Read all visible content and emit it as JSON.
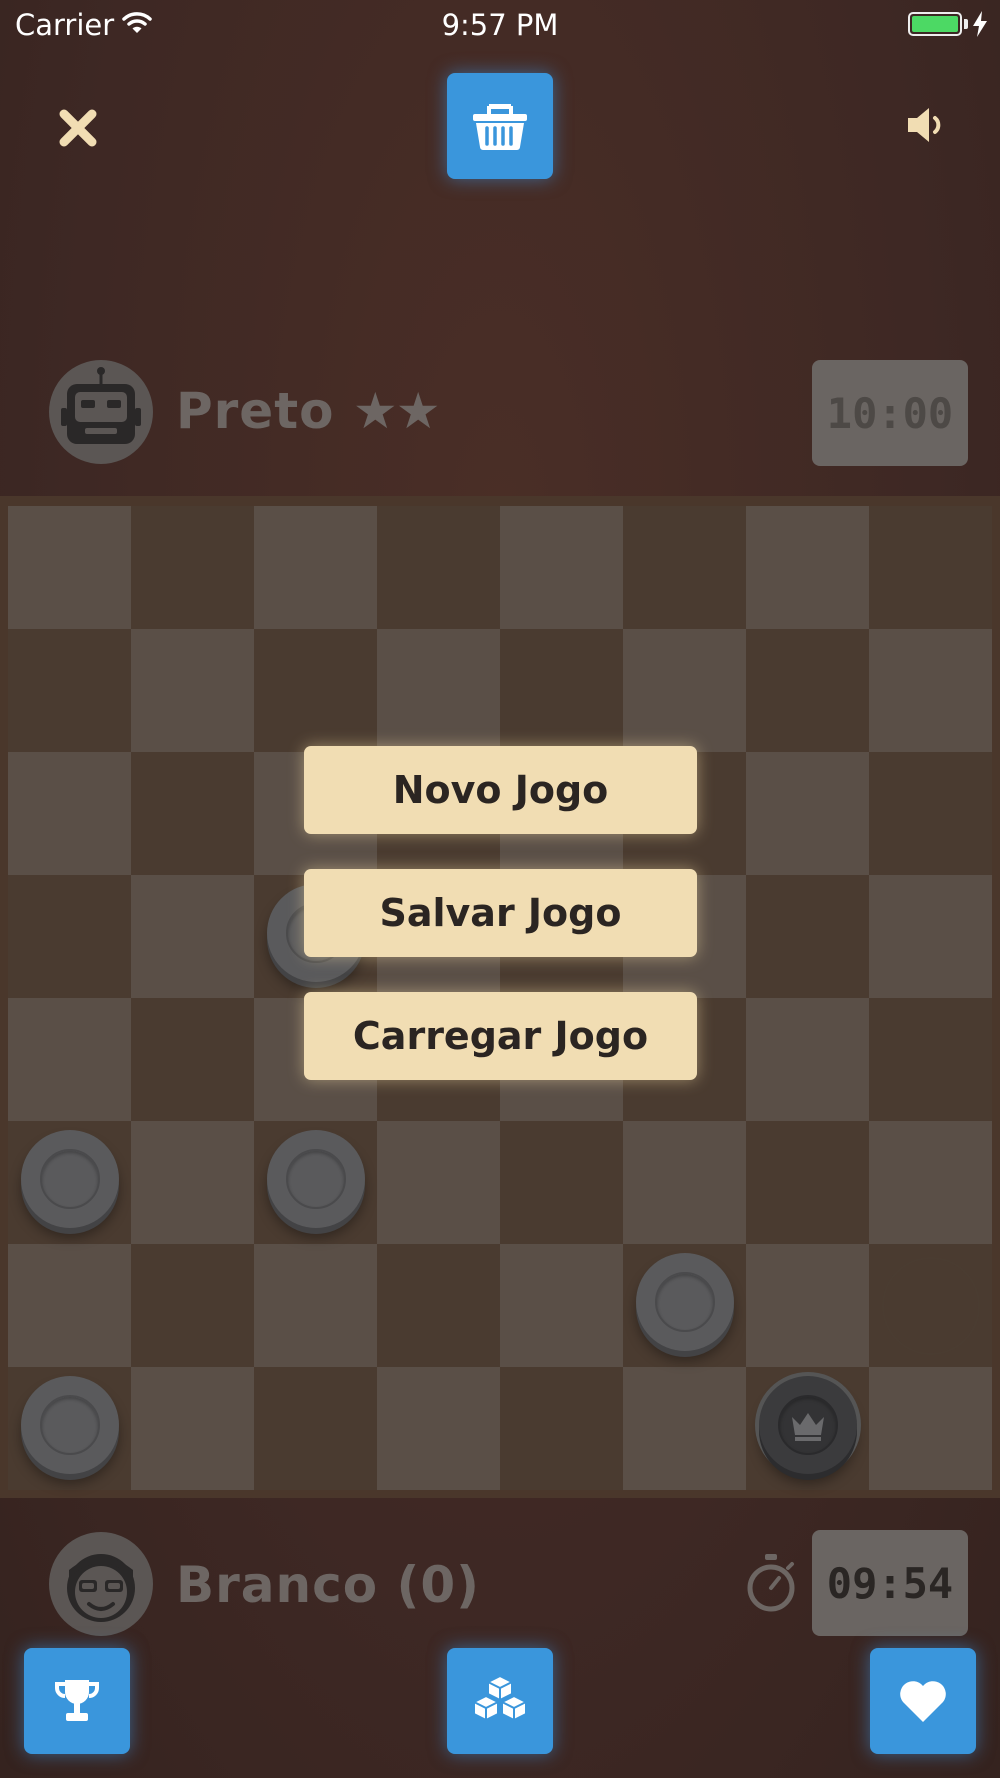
{
  "status_bar": {
    "carrier": "Carrier",
    "time": "9:57 PM"
  },
  "top_bar": {
    "close_icon": "close-icon",
    "shop_icon": "basket-icon",
    "sound_icon": "speaker-icon"
  },
  "opponent": {
    "name": "Preto",
    "stars": "★★",
    "timer": "10:00",
    "avatar_icon": "robot-icon"
  },
  "player": {
    "name": "Branco (0)",
    "timer": "09:54",
    "avatar_icon": "boy-glasses-icon",
    "stopwatch_icon": "stopwatch-icon"
  },
  "menu": {
    "new_game": "Novo Jogo",
    "save_game": "Salvar Jogo",
    "load_game": "Carregar Jogo"
  },
  "bottom_bar": {
    "trophy_icon": "trophy-icon",
    "blocks_icon": "blocks-icon",
    "heart_icon": "heart-icon"
  },
  "colors": {
    "accent_blue": "#3a96dc",
    "menu_button": "#f1ddb3",
    "background": "#3e2824",
    "battery": "#4cd964"
  },
  "board": {
    "size": 8,
    "pieces": [
      {
        "row": 3,
        "col": 2,
        "type": "man"
      },
      {
        "row": 5,
        "col": 0,
        "type": "man"
      },
      {
        "row": 5,
        "col": 2,
        "type": "man"
      },
      {
        "row": 6,
        "col": 5,
        "type": "man"
      },
      {
        "row": 7,
        "col": 0,
        "type": "man"
      },
      {
        "row": 7,
        "col": 6,
        "type": "king"
      }
    ],
    "ghosts": [
      {
        "row": 6,
        "col": 7
      }
    ]
  }
}
